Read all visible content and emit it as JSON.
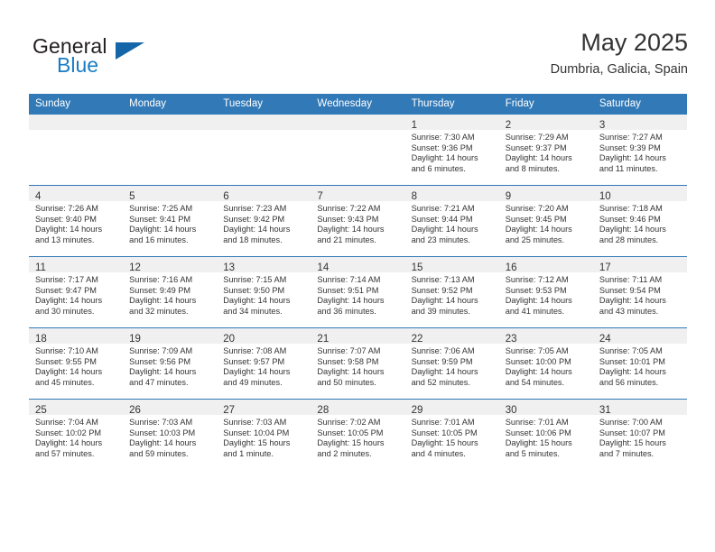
{
  "brand": {
    "word_one": "General",
    "word_two": "Blue",
    "triangle_icon": "triangle-icon",
    "accent_color": "#1a7dc4",
    "triangle_color": "#1566a8"
  },
  "header": {
    "title": "May 2025",
    "subtitle": "Dumbria, Galicia, Spain"
  },
  "calendar": {
    "header_bg": "#3179b7",
    "row_border_color": "#3179b7",
    "daynum_band_color": "#f0f0f0",
    "weekdays": [
      "Sunday",
      "Monday",
      "Tuesday",
      "Wednesday",
      "Thursday",
      "Friday",
      "Saturday"
    ],
    "weeks": [
      [
        {
          "day": "",
          "sunrise": "",
          "sunset": "",
          "daylight1": "",
          "daylight2": ""
        },
        {
          "day": "",
          "sunrise": "",
          "sunset": "",
          "daylight1": "",
          "daylight2": ""
        },
        {
          "day": "",
          "sunrise": "",
          "sunset": "",
          "daylight1": "",
          "daylight2": ""
        },
        {
          "day": "",
          "sunrise": "",
          "sunset": "",
          "daylight1": "",
          "daylight2": ""
        },
        {
          "day": "1",
          "sunrise": "Sunrise: 7:30 AM",
          "sunset": "Sunset: 9:36 PM",
          "daylight1": "Daylight: 14 hours",
          "daylight2": "and 6 minutes."
        },
        {
          "day": "2",
          "sunrise": "Sunrise: 7:29 AM",
          "sunset": "Sunset: 9:37 PM",
          "daylight1": "Daylight: 14 hours",
          "daylight2": "and 8 minutes."
        },
        {
          "day": "3",
          "sunrise": "Sunrise: 7:27 AM",
          "sunset": "Sunset: 9:39 PM",
          "daylight1": "Daylight: 14 hours",
          "daylight2": "and 11 minutes."
        }
      ],
      [
        {
          "day": "4",
          "sunrise": "Sunrise: 7:26 AM",
          "sunset": "Sunset: 9:40 PM",
          "daylight1": "Daylight: 14 hours",
          "daylight2": "and 13 minutes."
        },
        {
          "day": "5",
          "sunrise": "Sunrise: 7:25 AM",
          "sunset": "Sunset: 9:41 PM",
          "daylight1": "Daylight: 14 hours",
          "daylight2": "and 16 minutes."
        },
        {
          "day": "6",
          "sunrise": "Sunrise: 7:23 AM",
          "sunset": "Sunset: 9:42 PM",
          "daylight1": "Daylight: 14 hours",
          "daylight2": "and 18 minutes."
        },
        {
          "day": "7",
          "sunrise": "Sunrise: 7:22 AM",
          "sunset": "Sunset: 9:43 PM",
          "daylight1": "Daylight: 14 hours",
          "daylight2": "and 21 minutes."
        },
        {
          "day": "8",
          "sunrise": "Sunrise: 7:21 AM",
          "sunset": "Sunset: 9:44 PM",
          "daylight1": "Daylight: 14 hours",
          "daylight2": "and 23 minutes."
        },
        {
          "day": "9",
          "sunrise": "Sunrise: 7:20 AM",
          "sunset": "Sunset: 9:45 PM",
          "daylight1": "Daylight: 14 hours",
          "daylight2": "and 25 minutes."
        },
        {
          "day": "10",
          "sunrise": "Sunrise: 7:18 AM",
          "sunset": "Sunset: 9:46 PM",
          "daylight1": "Daylight: 14 hours",
          "daylight2": "and 28 minutes."
        }
      ],
      [
        {
          "day": "11",
          "sunrise": "Sunrise: 7:17 AM",
          "sunset": "Sunset: 9:47 PM",
          "daylight1": "Daylight: 14 hours",
          "daylight2": "and 30 minutes."
        },
        {
          "day": "12",
          "sunrise": "Sunrise: 7:16 AM",
          "sunset": "Sunset: 9:49 PM",
          "daylight1": "Daylight: 14 hours",
          "daylight2": "and 32 minutes."
        },
        {
          "day": "13",
          "sunrise": "Sunrise: 7:15 AM",
          "sunset": "Sunset: 9:50 PM",
          "daylight1": "Daylight: 14 hours",
          "daylight2": "and 34 minutes."
        },
        {
          "day": "14",
          "sunrise": "Sunrise: 7:14 AM",
          "sunset": "Sunset: 9:51 PM",
          "daylight1": "Daylight: 14 hours",
          "daylight2": "and 36 minutes."
        },
        {
          "day": "15",
          "sunrise": "Sunrise: 7:13 AM",
          "sunset": "Sunset: 9:52 PM",
          "daylight1": "Daylight: 14 hours",
          "daylight2": "and 39 minutes."
        },
        {
          "day": "16",
          "sunrise": "Sunrise: 7:12 AM",
          "sunset": "Sunset: 9:53 PM",
          "daylight1": "Daylight: 14 hours",
          "daylight2": "and 41 minutes."
        },
        {
          "day": "17",
          "sunrise": "Sunrise: 7:11 AM",
          "sunset": "Sunset: 9:54 PM",
          "daylight1": "Daylight: 14 hours",
          "daylight2": "and 43 minutes."
        }
      ],
      [
        {
          "day": "18",
          "sunrise": "Sunrise: 7:10 AM",
          "sunset": "Sunset: 9:55 PM",
          "daylight1": "Daylight: 14 hours",
          "daylight2": "and 45 minutes."
        },
        {
          "day": "19",
          "sunrise": "Sunrise: 7:09 AM",
          "sunset": "Sunset: 9:56 PM",
          "daylight1": "Daylight: 14 hours",
          "daylight2": "and 47 minutes."
        },
        {
          "day": "20",
          "sunrise": "Sunrise: 7:08 AM",
          "sunset": "Sunset: 9:57 PM",
          "daylight1": "Daylight: 14 hours",
          "daylight2": "and 49 minutes."
        },
        {
          "day": "21",
          "sunrise": "Sunrise: 7:07 AM",
          "sunset": "Sunset: 9:58 PM",
          "daylight1": "Daylight: 14 hours",
          "daylight2": "and 50 minutes."
        },
        {
          "day": "22",
          "sunrise": "Sunrise: 7:06 AM",
          "sunset": "Sunset: 9:59 PM",
          "daylight1": "Daylight: 14 hours",
          "daylight2": "and 52 minutes."
        },
        {
          "day": "23",
          "sunrise": "Sunrise: 7:05 AM",
          "sunset": "Sunset: 10:00 PM",
          "daylight1": "Daylight: 14 hours",
          "daylight2": "and 54 minutes."
        },
        {
          "day": "24",
          "sunrise": "Sunrise: 7:05 AM",
          "sunset": "Sunset: 10:01 PM",
          "daylight1": "Daylight: 14 hours",
          "daylight2": "and 56 minutes."
        }
      ],
      [
        {
          "day": "25",
          "sunrise": "Sunrise: 7:04 AM",
          "sunset": "Sunset: 10:02 PM",
          "daylight1": "Daylight: 14 hours",
          "daylight2": "and 57 minutes."
        },
        {
          "day": "26",
          "sunrise": "Sunrise: 7:03 AM",
          "sunset": "Sunset: 10:03 PM",
          "daylight1": "Daylight: 14 hours",
          "daylight2": "and 59 minutes."
        },
        {
          "day": "27",
          "sunrise": "Sunrise: 7:03 AM",
          "sunset": "Sunset: 10:04 PM",
          "daylight1": "Daylight: 15 hours",
          "daylight2": "and 1 minute."
        },
        {
          "day": "28",
          "sunrise": "Sunrise: 7:02 AM",
          "sunset": "Sunset: 10:05 PM",
          "daylight1": "Daylight: 15 hours",
          "daylight2": "and 2 minutes."
        },
        {
          "day": "29",
          "sunrise": "Sunrise: 7:01 AM",
          "sunset": "Sunset: 10:05 PM",
          "daylight1": "Daylight: 15 hours",
          "daylight2": "and 4 minutes."
        },
        {
          "day": "30",
          "sunrise": "Sunrise: 7:01 AM",
          "sunset": "Sunset: 10:06 PM",
          "daylight1": "Daylight: 15 hours",
          "daylight2": "and 5 minutes."
        },
        {
          "day": "31",
          "sunrise": "Sunrise: 7:00 AM",
          "sunset": "Sunset: 10:07 PM",
          "daylight1": "Daylight: 15 hours",
          "daylight2": "and 7 minutes."
        }
      ]
    ]
  }
}
